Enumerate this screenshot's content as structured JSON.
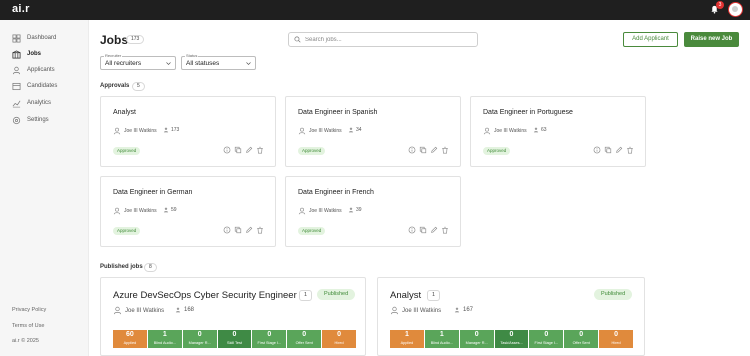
{
  "app": {
    "logo": "ai.r",
    "notification_count": "3"
  },
  "colors": {
    "brand_green": "#4a8a3c",
    "orange": "#e08a3c",
    "green": "#5aa55a",
    "dark_green": "#3f8a45",
    "alert_red": "#e03131"
  },
  "sidebar": {
    "items": [
      {
        "label": "Dashboard",
        "icon": "dashboard-icon"
      },
      {
        "label": "Jobs",
        "icon": "jobs-icon"
      },
      {
        "label": "Applicants",
        "icon": "applicants-icon"
      },
      {
        "label": "Candidates",
        "icon": "candidates-icon"
      },
      {
        "label": "Analytics",
        "icon": "analytics-icon"
      },
      {
        "label": "Settings",
        "icon": "settings-icon"
      }
    ],
    "footer": [
      "Privacy Policy",
      "Terms of Use",
      "ai.r © 2025"
    ]
  },
  "header": {
    "title": "Jobs",
    "count": "173",
    "search_placeholder": "Search jobs...",
    "add_applicant": "Add Applicant",
    "raise_job": "Raise new Job"
  },
  "filters": {
    "recruiter": {
      "label": "Recruiter",
      "value": "All recruiters"
    },
    "status": {
      "label": "Status",
      "value": "All statuses"
    }
  },
  "approvals": {
    "label": "Approvals",
    "count": "5",
    "cards": [
      {
        "title": "Analyst",
        "user": "Joe III Watkins",
        "count": "173",
        "status": "Approved"
      },
      {
        "title": "Data Engineer in Spanish",
        "user": "Joe III Watkins",
        "count": "34",
        "status": "Approved"
      },
      {
        "title": "Data Engineer in Portuguese",
        "user": "Joe III Watkins",
        "count": "63",
        "status": "Approved"
      },
      {
        "title": "Data Engineer in German",
        "user": "Joe III Watkins",
        "count": "59",
        "status": "Approved"
      },
      {
        "title": "Data Engineer in French",
        "user": "Joe III Watkins",
        "count": "39",
        "status": "Approved"
      }
    ]
  },
  "published": {
    "label": "Published jobs",
    "count": "8",
    "cards": [
      {
        "title": "Azure DevSecOps Cyber Security Engineer",
        "count": "1",
        "status": "Published",
        "user": "Joe III Watkins",
        "applicants": "168",
        "stages": [
          {
            "value": "60",
            "label": "Applied",
            "color": "orange"
          },
          {
            "value": "1",
            "label": "Blind Audio...",
            "color": "green"
          },
          {
            "value": "0",
            "label": "Manager R...",
            "color": "green"
          },
          {
            "value": "0",
            "label": "Skill Test",
            "color": "dark_green"
          },
          {
            "value": "0",
            "label": "First Stage I...",
            "color": "green"
          },
          {
            "value": "0",
            "label": "Offer Sent",
            "color": "green"
          },
          {
            "value": "0",
            "label": "Hired",
            "color": "orange"
          }
        ]
      },
      {
        "title": "Analyst",
        "count": "1",
        "status": "Published",
        "user": "Joe III Watkins",
        "applicants": "167",
        "stages": [
          {
            "value": "1",
            "label": "Applied",
            "color": "orange"
          },
          {
            "value": "1",
            "label": "Blind Audio...",
            "color": "green"
          },
          {
            "value": "0",
            "label": "Manager R...",
            "color": "green"
          },
          {
            "value": "0",
            "label": "Task/Asses...",
            "color": "dark_green"
          },
          {
            "value": "0",
            "label": "First Stage I...",
            "color": "green"
          },
          {
            "value": "0",
            "label": "Offer Sent",
            "color": "green"
          },
          {
            "value": "0",
            "label": "Hired",
            "color": "orange"
          }
        ]
      }
    ]
  }
}
